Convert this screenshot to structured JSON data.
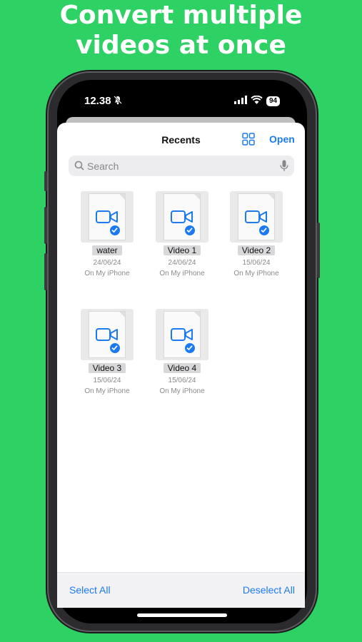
{
  "headline": {
    "line1": "Convert multiple",
    "line2": "videos at once"
  },
  "status_bar": {
    "time": "12.38",
    "battery": "94"
  },
  "picker": {
    "title": "Recents",
    "open_label": "Open",
    "search_placeholder": "Search",
    "files": [
      {
        "name": "water",
        "date": "24/06/24",
        "location": "On My iPhone",
        "selected": true
      },
      {
        "name": "Video 1",
        "date": "24/06/24",
        "location": "On My iPhone",
        "selected": true
      },
      {
        "name": "Video 2",
        "date": "15/06/24",
        "location": "On My iPhone",
        "selected": true
      },
      {
        "name": "Video 3",
        "date": "15/06/24",
        "location": "On My iPhone",
        "selected": true
      },
      {
        "name": "Video 4",
        "date": "15/06/24",
        "location": "On My iPhone",
        "selected": true
      }
    ],
    "select_all_label": "Select All",
    "deselect_all_label": "Deselect All"
  },
  "colors": {
    "background": "#2dd164",
    "accent": "#1b7af2"
  }
}
